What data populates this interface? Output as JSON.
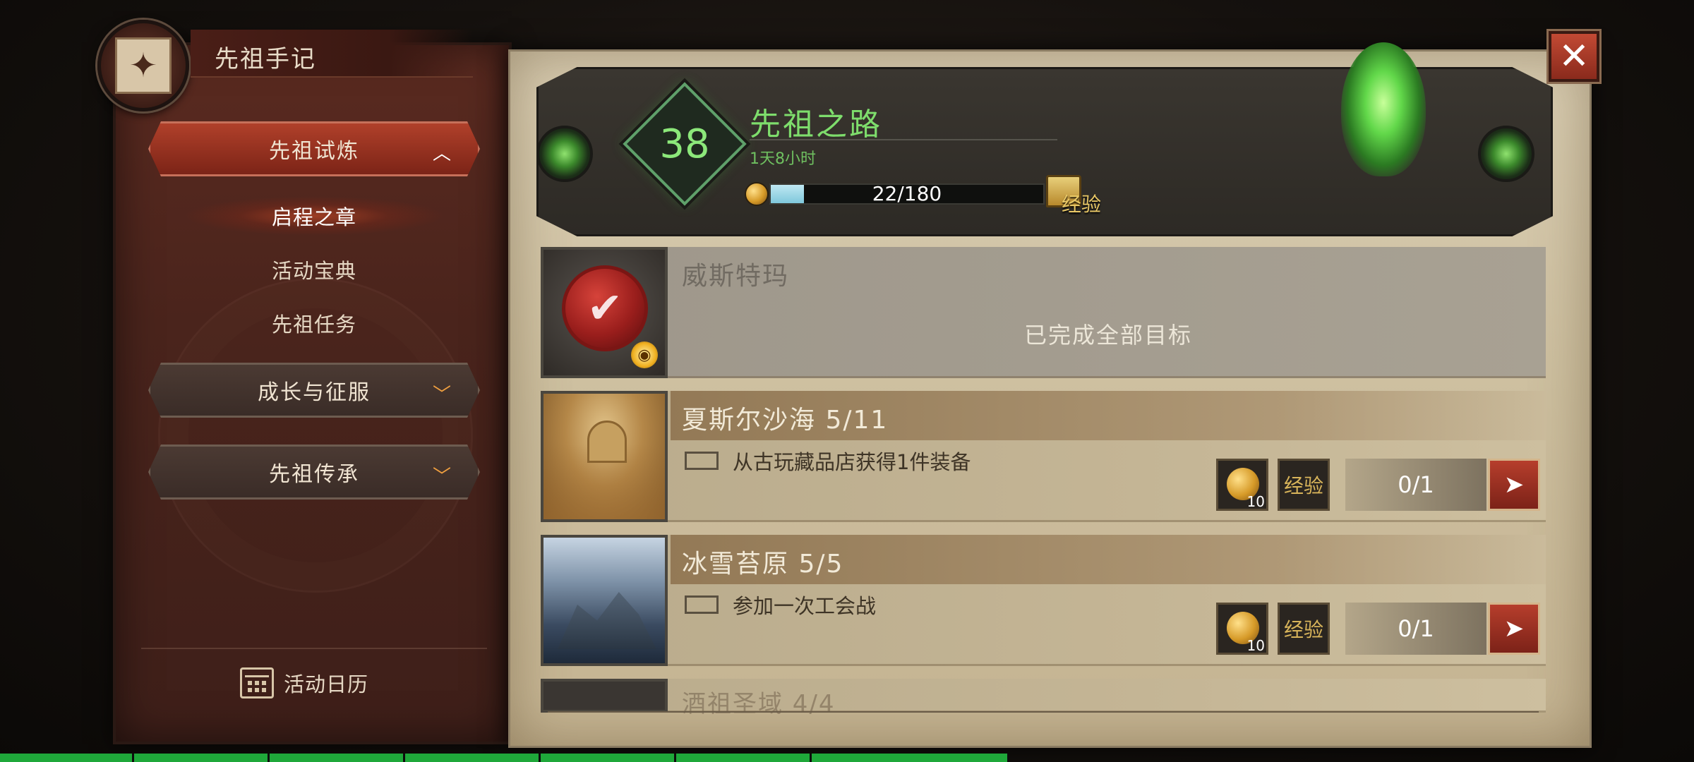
{
  "app": {
    "title": "先祖手记",
    "close_label": "✕"
  },
  "sidebar": {
    "sections": [
      {
        "label": "先祖试炼",
        "expanded": true,
        "chevron": "^"
      },
      {
        "label": "成长与征服",
        "expanded": false,
        "chevron": "v"
      },
      {
        "label": "先祖传承",
        "expanded": false,
        "chevron": "v"
      }
    ],
    "sub_items": [
      {
        "label": "启程之章",
        "selected": true
      },
      {
        "label": "活动宝典",
        "selected": false
      },
      {
        "label": "先祖任务",
        "selected": false
      }
    ],
    "calendar_label": "活动日历"
  },
  "header": {
    "level": "38",
    "title": "先祖之路",
    "time_remaining": "1天8小时",
    "xp_text": "22/180",
    "xp_fraction": 0.122,
    "chest_label": "经验"
  },
  "quests": [
    {
      "title": "威斯特玛",
      "completed": true,
      "complete_msg": "已完成全部目标",
      "icon": "wax-seal-check-icon"
    },
    {
      "title": "夏斯尔沙海 5/11",
      "completed": false,
      "task": "从古玩藏品店获得1件装备",
      "reward_qty": "10",
      "exp_label": "经验",
      "progress": "0/1",
      "icon": "desert-city-thumbnail"
    },
    {
      "title": "冰雪苔原 5/5",
      "completed": false,
      "task": "参加一次工会战",
      "reward_qty": "10",
      "exp_label": "经验",
      "progress": "0/1",
      "icon": "snow-tundra-thumbnail"
    }
  ],
  "next_card_title": "酒祖圣域 4/4",
  "colors": {
    "accent_green": "#7edd6c",
    "active_red": "#b0402a",
    "parchment": "#cdbf9f"
  }
}
